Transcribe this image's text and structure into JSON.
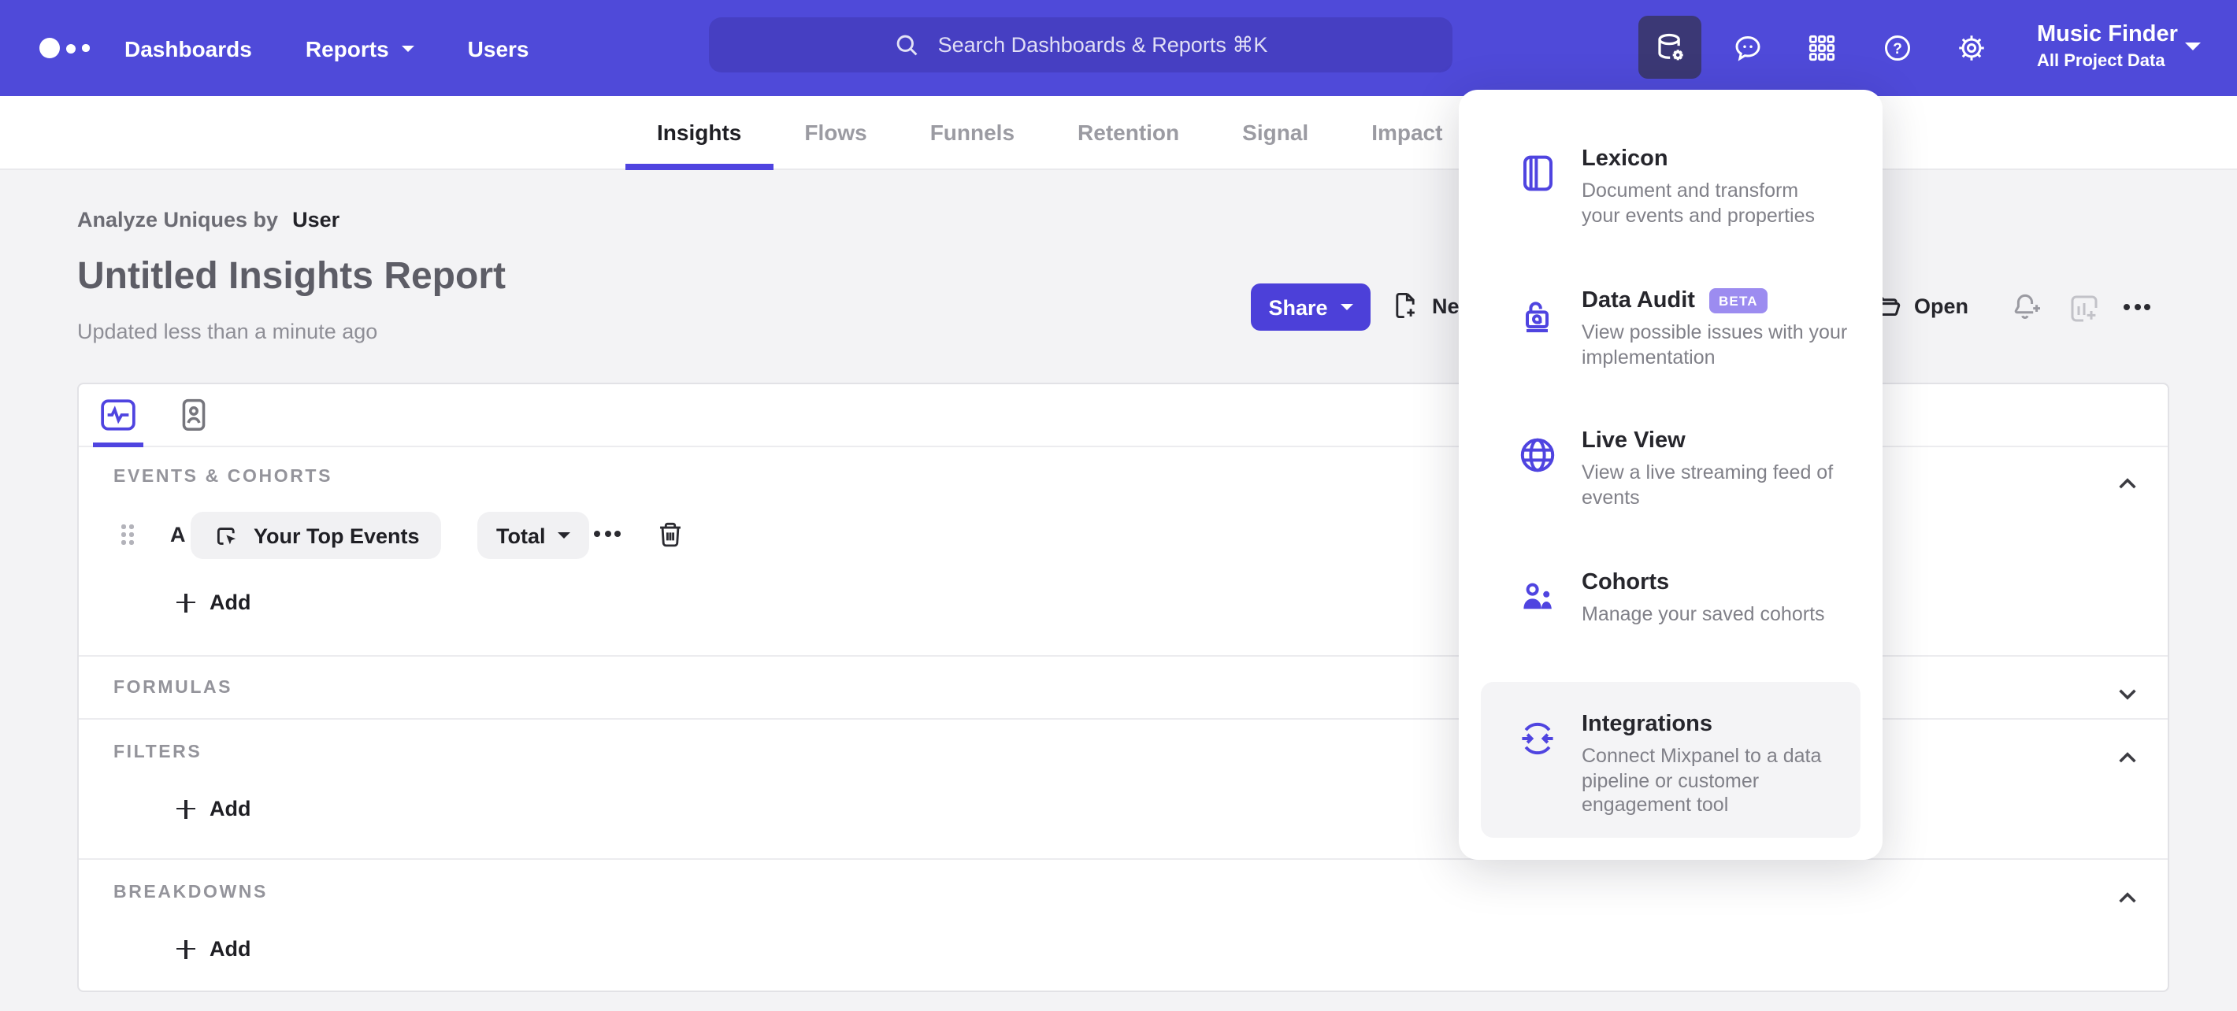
{
  "colors": {
    "accent": "#4f44e0",
    "topbar_bg": "#4f4ad9",
    "search_bg": "#463fc2",
    "active_tile_bg": "#3b3875",
    "beta_badge_bg": "#9c8cf0",
    "page_bg": "#f3f3f5",
    "share_button_bg": "#4c40d9"
  },
  "topnav": {
    "items": [
      {
        "label": "Dashboards"
      },
      {
        "label": "Reports"
      },
      {
        "label": "Users"
      }
    ],
    "search_placeholder": "Search Dashboards & Reports ⌘K",
    "project_name": "Music Finder",
    "project_subtitle": "All Project Data"
  },
  "tabs": [
    {
      "label": "Insights",
      "active": true
    },
    {
      "label": "Flows"
    },
    {
      "label": "Funnels"
    },
    {
      "label": "Retention"
    },
    {
      "label": "Signal"
    },
    {
      "label": "Impact"
    }
  ],
  "header": {
    "analyze_label": "Analyze Uniques by",
    "analyze_value": "User",
    "title": "Untitled Insights Report",
    "updated": "Updated less than a minute ago",
    "share_label": "Share",
    "new_label": "New",
    "open_label": "Open"
  },
  "builder": {
    "sections": [
      {
        "label": "EVENTS & COHORTS",
        "state": "expanded"
      },
      {
        "label": "FORMULAS",
        "state": "collapsed"
      },
      {
        "label": "FILTERS",
        "state": "expanded"
      },
      {
        "label": "BREAKDOWNS",
        "state": "expanded"
      }
    ],
    "row": {
      "letter": "A",
      "event": "Your Top Events",
      "metric": "Total"
    },
    "add_label": "Add"
  },
  "menu": {
    "items": [
      {
        "title": "Lexicon",
        "desc_lines": [
          "Document and transform",
          "your events and properties"
        ]
      },
      {
        "title": "Data Audit",
        "badge": "BETA",
        "desc_lines": [
          "View possible issues with your",
          "implementation"
        ]
      },
      {
        "title": "Live View",
        "desc_lines": [
          "View a live streaming feed of",
          "events"
        ]
      },
      {
        "title": "Cohorts",
        "desc_lines": [
          "Manage your saved cohorts"
        ]
      },
      {
        "title": "Integrations",
        "highlighted": true,
        "desc_lines": [
          "Connect Mixpanel to a data",
          "pipeline or customer",
          "engagement tool"
        ]
      }
    ]
  },
  "icons": {
    "logo": "mixpanel-dots",
    "search": "magnifier",
    "data_management": "database-gear",
    "feedback": "chat-bubble-eyes",
    "apps": "grid-3x3",
    "help": "question-circle",
    "settings": "gear",
    "new": "document-plus",
    "open": "folder",
    "alert": "bell-plus",
    "add_to_dashboard": "chart-plus",
    "more": "ellipsis",
    "delete": "trash",
    "drag": "drag-handle",
    "metrics_tab": "pulse-square",
    "profiles_tab": "person-card",
    "event_picker": "cursor-square",
    "lexicon": "book",
    "data_audit": "lock-spiral",
    "live_view": "globe",
    "cohorts": "people",
    "integrations": "sync-arrows"
  }
}
